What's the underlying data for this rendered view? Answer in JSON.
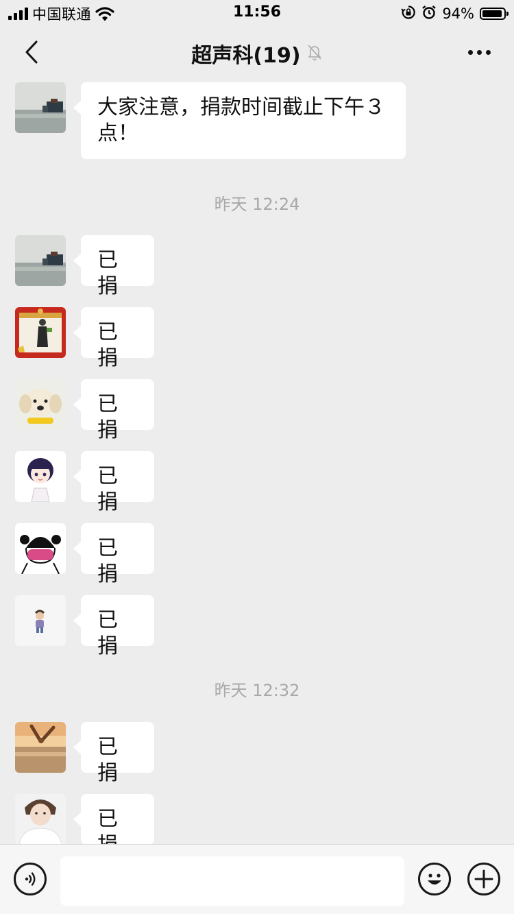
{
  "status_bar": {
    "carrier": "中国联通",
    "time": "11:56",
    "battery_percent_text": "94%",
    "battery_level": 0.94,
    "icons": [
      "signal-icon",
      "wifi-icon",
      "orientation-lock-icon",
      "alarm-icon",
      "battery-icon"
    ]
  },
  "nav": {
    "title": "超声科(19)",
    "icons": [
      "back-chevron-icon",
      "mute-bell-icon",
      "more-icon"
    ]
  },
  "chat": {
    "top_message": {
      "text": "大家注意，捐款时间截止下午３点！",
      "avatar": "lakeside-building"
    },
    "groups": [
      {
        "time": "昨天 12:24",
        "messages": [
          {
            "text": "已捐",
            "avatar": "lakeside-building"
          },
          {
            "text": "已捐",
            "avatar": "man-red-frame"
          },
          {
            "text": "已捐",
            "avatar": "puppy"
          },
          {
            "text": "已捐",
            "avatar": "cartoon-girl"
          },
          {
            "text": "已捐",
            "avatar": "masked-girl-sketch"
          },
          {
            "text": "已捐",
            "avatar": "small-figure"
          }
        ]
      },
      {
        "time": "昨天 12:32",
        "messages": [
          {
            "text": "已捐",
            "avatar": "sunset-hands"
          },
          {
            "text": "已捐",
            "avatar": "person-white"
          }
        ]
      }
    ]
  },
  "input_bar": {
    "placeholder": "",
    "icons": [
      "voice-icon",
      "emoji-icon",
      "plus-icon"
    ]
  }
}
